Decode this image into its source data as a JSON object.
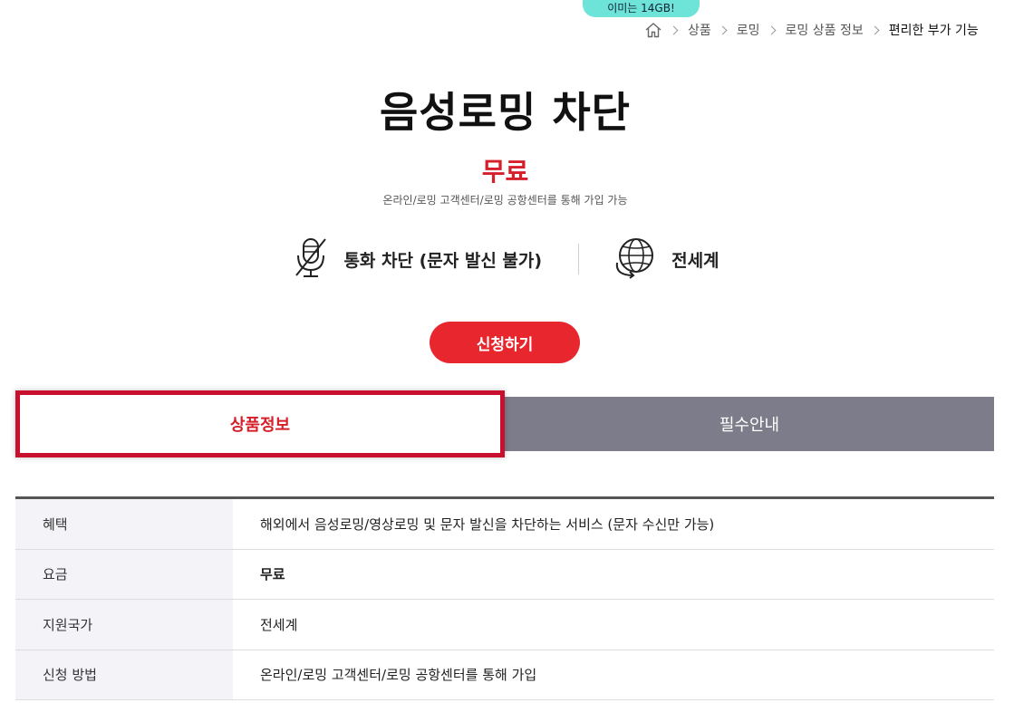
{
  "tooltip": {
    "text": "이미는 14GB!"
  },
  "breadcrumb": {
    "home_icon": "home-icon",
    "items": [
      "상품",
      "로밍",
      "로밍 상품 정보",
      "편리한 부가 기능"
    ]
  },
  "product": {
    "title": "음성로밍 차단",
    "price": "무료",
    "note": "온라인/로밍 고객센터/로밍 공항센터를 통해 가입 가능"
  },
  "features": [
    {
      "icon": "muted-mic-icon",
      "label": "통화 차단 (문자 발신 불가)"
    },
    {
      "icon": "globe-icon",
      "label": "전세계"
    }
  ],
  "apply_button": {
    "label": "신청하기"
  },
  "tabs": [
    {
      "label": "상품정보",
      "active": true
    },
    {
      "label": "필수안내",
      "active": false
    }
  ],
  "info_table": [
    {
      "header": "혜택",
      "value": "해외에서 음성로밍/영상로밍 및 문자 발신을 차단하는 서비스 (문자 수신만 가능)",
      "bold": false
    },
    {
      "header": "요금",
      "value": "무료",
      "bold": true
    },
    {
      "header": "지원국가",
      "value": "전세계",
      "bold": false
    },
    {
      "header": "신청 방법",
      "value": "온라인/로밍 고객센터/로밍 공항센터를 통해 가입",
      "bold": false
    }
  ],
  "colors": {
    "accent_red": "#e8262d",
    "price_red": "#d51f2a",
    "tab_inactive": "#7d7c8a",
    "tooltip_teal": "#6ee3d7"
  }
}
